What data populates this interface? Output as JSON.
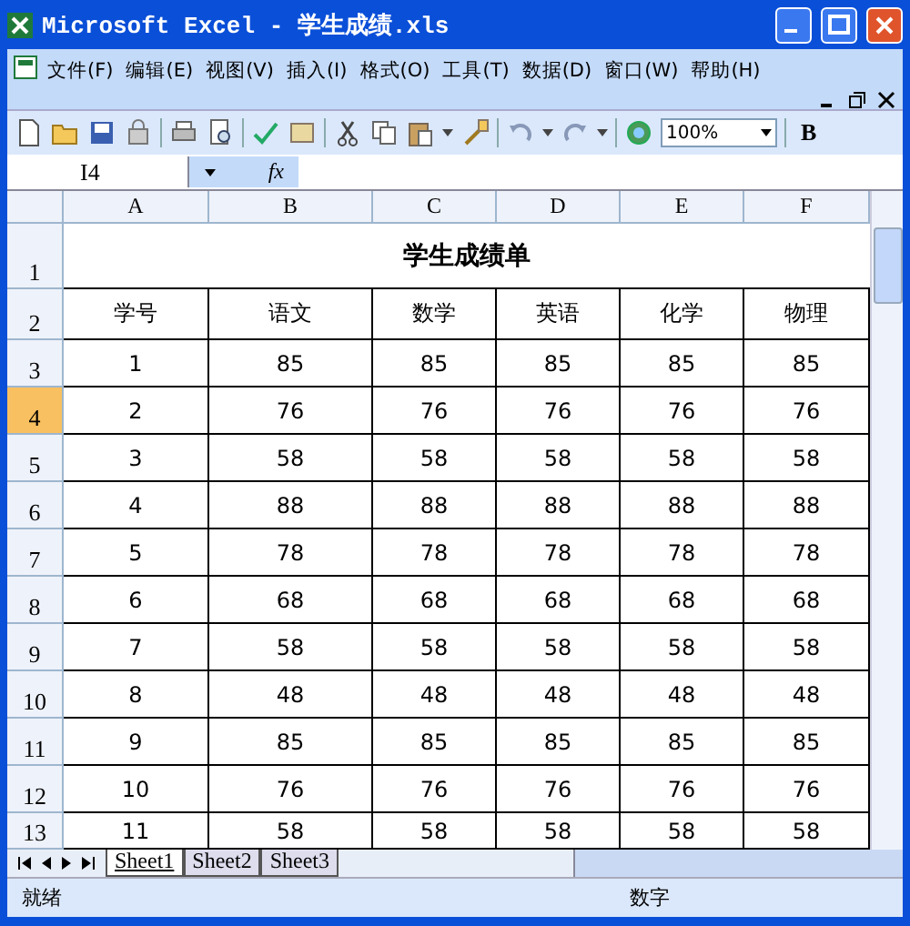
{
  "window": {
    "title": "Microsoft Excel - 学生成绩.xls"
  },
  "menu": [
    "文件(F)",
    "编辑(E)",
    "视图(V)",
    "插入(I)",
    "格式(O)",
    "工具(T)",
    "数据(D)",
    "窗口(W)",
    "帮助(H)"
  ],
  "toolbar": {
    "zoom": "100%",
    "bold": "B"
  },
  "formula_bar": {
    "name_box": "I4",
    "fx": "fx"
  },
  "columns": [
    "A",
    "B",
    "C",
    "D",
    "E",
    "F"
  ],
  "rows": [
    {
      "header": "1",
      "selected": false,
      "kind": "title",
      "cells": [
        "学生成绩单"
      ]
    },
    {
      "header": "2",
      "selected": false,
      "kind": "data",
      "cells": [
        "学号",
        "语文",
        "数学",
        "英语",
        "化学",
        "物理"
      ]
    },
    {
      "header": "3",
      "selected": false,
      "kind": "data",
      "cells": [
        "1",
        "85",
        "85",
        "85",
        "85",
        "85"
      ]
    },
    {
      "header": "4",
      "selected": true,
      "kind": "data",
      "cells": [
        "2",
        "76",
        "76",
        "76",
        "76",
        "76"
      ]
    },
    {
      "header": "5",
      "selected": false,
      "kind": "data",
      "cells": [
        "3",
        "58",
        "58",
        "58",
        "58",
        "58"
      ]
    },
    {
      "header": "6",
      "selected": false,
      "kind": "data",
      "cells": [
        "4",
        "88",
        "88",
        "88",
        "88",
        "88"
      ]
    },
    {
      "header": "7",
      "selected": false,
      "kind": "data",
      "cells": [
        "5",
        "78",
        "78",
        "78",
        "78",
        "78"
      ]
    },
    {
      "header": "8",
      "selected": false,
      "kind": "data",
      "cells": [
        "6",
        "68",
        "68",
        "68",
        "68",
        "68"
      ]
    },
    {
      "header": "9",
      "selected": false,
      "kind": "data",
      "cells": [
        "7",
        "58",
        "58",
        "58",
        "58",
        "58"
      ]
    },
    {
      "header": "10",
      "selected": false,
      "kind": "data",
      "cells": [
        "8",
        "48",
        "48",
        "48",
        "48",
        "48"
      ]
    },
    {
      "header": "11",
      "selected": false,
      "kind": "data",
      "cells": [
        "9",
        "85",
        "85",
        "85",
        "85",
        "85"
      ]
    },
    {
      "header": "12",
      "selected": false,
      "kind": "data",
      "cells": [
        "10",
        "76",
        "76",
        "76",
        "76",
        "76"
      ]
    },
    {
      "header": "13",
      "selected": false,
      "kind": "data",
      "cells": [
        "11",
        "58",
        "58",
        "58",
        "58",
        "58"
      ]
    }
  ],
  "sheet_tabs": [
    {
      "label": "Sheet1",
      "selected": true
    },
    {
      "label": "Sheet2",
      "selected": false
    },
    {
      "label": "Sheet3",
      "selected": false
    }
  ],
  "status_bar": {
    "state": "就绪",
    "mode": "数字"
  }
}
